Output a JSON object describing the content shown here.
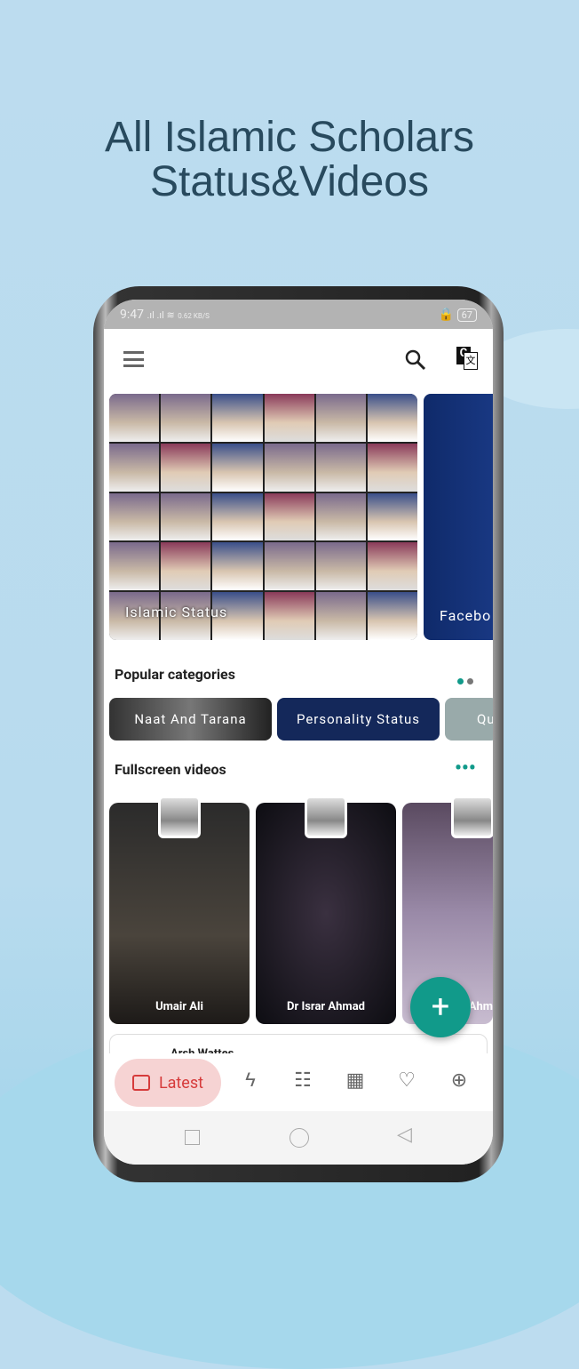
{
  "headline": {
    "line1": "All Islamic Scholars",
    "line2": "Status&Videos"
  },
  "status_bar": {
    "time": "9:47",
    "speed": "0.62 KB/S",
    "battery": "67"
  },
  "app_bar": {
    "menu_icon": "hamburger-icon",
    "search_icon": "search-icon",
    "translate_icon": "google-translate-icon"
  },
  "banners": [
    {
      "label": "Islamic Status"
    },
    {
      "label": "Facebo"
    }
  ],
  "popular": {
    "title": "Popular categories",
    "chips": [
      "Naat And Tarana",
      "Personality Status",
      "Qu"
    ]
  },
  "fullscreen": {
    "title": "Fullscreen videos",
    "videos": [
      "Umair Ali",
      "Dr Israr Ahmad",
      "Ahm"
    ]
  },
  "list_peek": "Arsh Wattes",
  "bottom_nav": {
    "active_label": "Latest",
    "items": [
      "store-icon",
      "lightning-icon",
      "inbox-icon",
      "grid-icon",
      "heart-icon",
      "download-icon"
    ]
  },
  "colors": {
    "accent": "#119a8a",
    "active_nav": "#d63b3b",
    "active_nav_bg": "#f6d3d3"
  }
}
